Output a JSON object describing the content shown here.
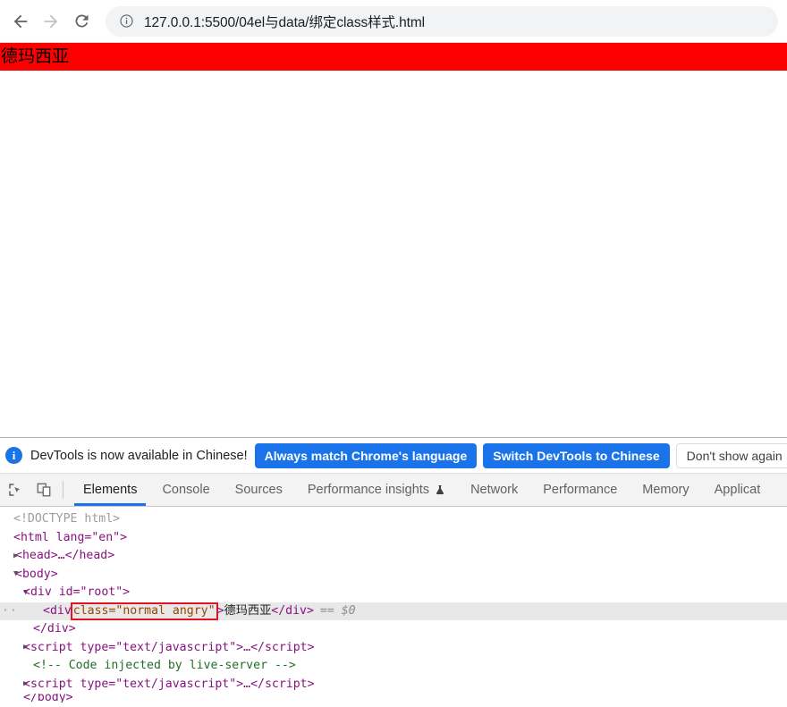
{
  "browser": {
    "back_label": "Back",
    "forward_label": "Forward",
    "reload_label": "Reload",
    "site_info_icon": "info-circle-icon",
    "url": "127.0.0.1:5500/04el与data/绑定class样式.html"
  },
  "page": {
    "banner_text": "德玛西亚",
    "banner_color": "#ff0000",
    "banner_text_color": "#000000"
  },
  "devtools": {
    "notice": {
      "icon": "info-icon",
      "message": "DevTools is now available in Chinese!",
      "primary_button": "Always match Chrome's language",
      "secondary_button": "Switch DevTools to Chinese",
      "dismiss_button": "Don't show again",
      "accent_color": "#1a73e8"
    },
    "tools": {
      "inspect_icon": "inspect-element-icon",
      "device_icon": "device-toolbar-icon"
    },
    "tabs": [
      {
        "label": "Elements",
        "active": true
      },
      {
        "label": "Console",
        "active": false
      },
      {
        "label": "Sources",
        "active": false
      },
      {
        "label": "Performance insights",
        "active": false,
        "icon": "flask-icon"
      },
      {
        "label": "Network",
        "active": false
      },
      {
        "label": "Performance",
        "active": false
      },
      {
        "label": "Memory",
        "active": false
      },
      {
        "label": "Applicat",
        "active": false
      }
    ],
    "dom": {
      "doctype": "<!DOCTYPE html>",
      "html_open": "<html lang=\"en\">",
      "head_collapsed": "<head>…</head>",
      "body_open": "<body>",
      "root_div": "<div id=\"root\">",
      "selected": {
        "tag_open": "<div",
        "attr": "class=\"normal angry\"",
        "tag_close_bracket": ">",
        "text": "德玛西亚",
        "tag_end": "</div>",
        "ref": "== $0"
      },
      "root_close": "</div>",
      "script1": "<script type=\"text/javascript\">…</script>",
      "comment": "<!-- Code injected by live-server -->",
      "script2": "<script type=\"text/javascript\">…</script>",
      "body_close": "</body>"
    }
  }
}
